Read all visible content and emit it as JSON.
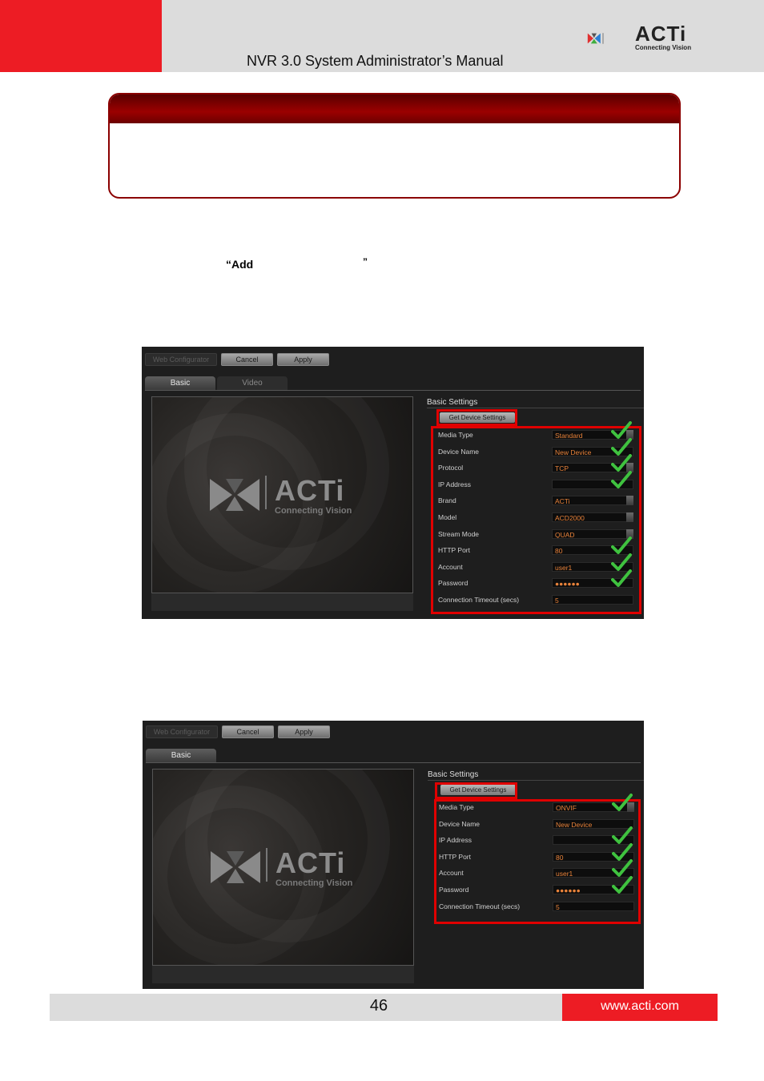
{
  "header": {
    "title": "NVR 3.0 System Administrator’s Manual",
    "brand": "ACTi",
    "brand_tagline": "Connecting Vision"
  },
  "body": {
    "add_text": "“Add",
    "add_close_quote": "”"
  },
  "screens": [
    {
      "toolbar": [
        "Web Configurator",
        "Cancel",
        "Apply"
      ],
      "tabs": [
        "Basic",
        "Video"
      ],
      "preview_brand": "ACTi",
      "preview_tagline": "Connecting Vision",
      "section_title": "Basic Settings",
      "get_settings_label": "Get Device Settings",
      "fields": [
        {
          "label": "Media Type",
          "value": "Standard",
          "dropdown": true,
          "check": true
        },
        {
          "label": "Device Name",
          "value": "New Device",
          "dropdown": false,
          "check": true
        },
        {
          "label": "Protocol",
          "value": "TCP",
          "dropdown": true,
          "check": true
        },
        {
          "label": "IP Address",
          "value": "",
          "dropdown": false,
          "check": true
        },
        {
          "label": "Brand",
          "value": "ACTi",
          "dropdown": true,
          "check": false
        },
        {
          "label": "Model",
          "value": "ACD2000",
          "dropdown": true,
          "check": false
        },
        {
          "label": "Stream Mode",
          "value": "QUAD",
          "dropdown": true,
          "check": false
        },
        {
          "label": "HTTP Port",
          "value": "80",
          "dropdown": false,
          "check": true
        },
        {
          "label": "Account",
          "value": "user1",
          "dropdown": false,
          "check": true
        },
        {
          "label": "Password",
          "value": "●●●●●●",
          "dropdown": false,
          "check": true
        },
        {
          "label": "Connection Timeout (secs)",
          "value": "5",
          "dropdown": false,
          "check": false
        }
      ]
    },
    {
      "toolbar": [
        "Web Configurator",
        "Cancel",
        "Apply"
      ],
      "tabs": [
        "Basic"
      ],
      "preview_brand": "ACTi",
      "preview_tagline": "Connecting Vision",
      "section_title": "Basic Settings",
      "get_settings_label": "Get Device Settings",
      "fields": [
        {
          "label": "Media Type",
          "value": "ONVIF",
          "dropdown": true,
          "check": true
        },
        {
          "label": "Device Name",
          "value": "New Device",
          "dropdown": false,
          "check": false
        },
        {
          "label": "IP Address",
          "value": "",
          "dropdown": false,
          "check": true
        },
        {
          "label": "HTTP Port",
          "value": "80",
          "dropdown": false,
          "check": true
        },
        {
          "label": "Account",
          "value": "user1",
          "dropdown": false,
          "check": true
        },
        {
          "label": "Password",
          "value": "●●●●●●",
          "dropdown": false,
          "check": true
        },
        {
          "label": "Connection Timeout (secs)",
          "value": "5",
          "dropdown": false,
          "check": false
        }
      ]
    }
  ],
  "footer": {
    "page_number": "46",
    "url": "www.acti.com"
  },
  "colors": {
    "brand_red": "#ed1c24",
    "note_dark_red": "#8b0000",
    "highlight_red": "#e00000",
    "check_green": "#3fc23f",
    "field_value": "#e8823a"
  }
}
